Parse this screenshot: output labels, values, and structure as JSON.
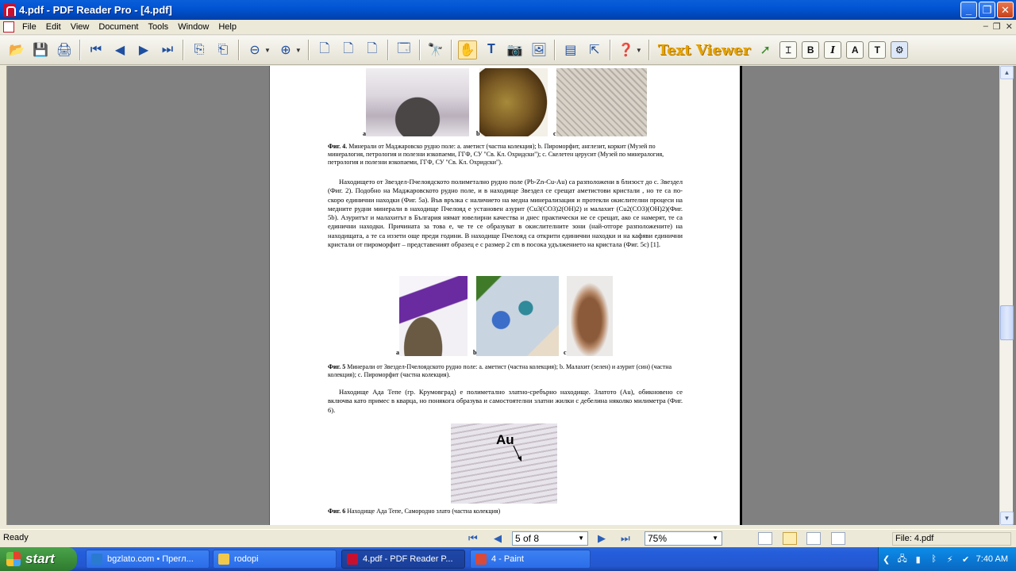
{
  "window": {
    "title": "4.pdf - PDF Reader Pro - [4.pdf]"
  },
  "menu": [
    "File",
    "Edit",
    "View",
    "Document",
    "Tools",
    "Window",
    "Help"
  ],
  "toolbar": {
    "text_viewer_label": "Text Viewer",
    "bold": "B",
    "italic": "I",
    "font": "A",
    "text": "T"
  },
  "document": {
    "fig4_labels": [
      "a",
      "b",
      "c"
    ],
    "fig4_caption_bold": "Фиг. 4.",
    "fig4_caption": "Минерали от Маджаровско рудно поле: a. аметист (частна колекция); b. Пироморфит, англезит, коркит (Музей по минералогия, петрология и полезни изкопаеми, ГГФ, СУ \"Св. Кл. Охридски\"); c. Скелетен церусит (Музей по минералогия, петрология и полезни изкопаеми, ГГФ, СУ \"Св. Кл. Охридски\").",
    "para1": "Находището от Звездел-Пчелоядското полиметално рудно поле (Pb-Zn-Cu-Au) са разположени в близост до с. Звездел (Фиг. 2). Подобно на Маджаровското рудно поле, и в находище Звездел се срещат аметистови кристали , но те са по-скоро единични находки (Фиг. 5а). Във връзка с наличието на медна минерализация и протекли окислителни процеси на медните рудни минерали в находище Пчелояд е установен азурит (Cu3(CO3)2(OH)2) и малахит (Cu2(CO3)(OH)2)(Фиг. 5b). Азуритът и малахитът в България нямат ювелирни качества и днес практически не се срещат, ако се намерят, те са единични находки. Причината за това е, че те се образуват в окислителните зони (най-отгоре разположените) на находищата, а те са иззети още преди години. В находище Пчелояд са открити единични находки и на кафяви единични кристали от пироморфит – представеният образец е с размер 2 cm в посока удължението на кристала (Фиг. 5с) [1].",
    "fig5_labels": [
      "a",
      "b",
      "c"
    ],
    "fig5_caption_bold": "Фиг. 5",
    "fig5_caption": "Минерали от Звездел-Пчелоядското рудно поле: a. аметист (частна колекция); b. Малахит (зелен) и азурит (син) (частна колекция); c. Пироморфит (частна колекция).",
    "para2": "Находище Ада Тепе (гр. Крумовград) е полиметално златно-сребърно находище. Златото (Au), обикновено се включва като примес в кварца, но понякога образува и самостоятелни златни жилки с дебелина няколко милиметра (Фиг. 6).",
    "fig6_label": "Au",
    "fig6_caption_bold": "Фиг. 6",
    "fig6_caption": "Находище Ада Тепе, Самородно злато (частна колекция)"
  },
  "status": {
    "ready": "Ready",
    "page": "5 of 8",
    "zoom": "75%",
    "file": "File: 4.pdf"
  },
  "taskbar": {
    "start": "start",
    "tasks": [
      "bgzlato.com • Прегл...",
      "rodopi",
      "4.pdf - PDF Reader P...",
      "4 - Paint"
    ],
    "time": "7:40 AM"
  }
}
